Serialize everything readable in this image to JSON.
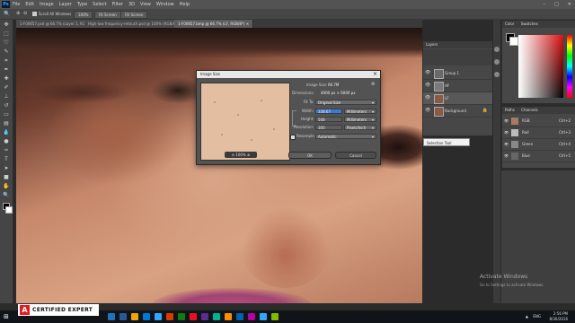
{
  "menubar": {
    "logo": "Ps",
    "items": [
      "File",
      "Edit",
      "Image",
      "Layer",
      "Type",
      "Select",
      "Filter",
      "3D",
      "View",
      "Window",
      "Help"
    ]
  },
  "options": {
    "scroll_all": "Scroll All Windows",
    "zoom_pct": "100%",
    "fit_screen": "Fit Screen",
    "fill_screen": "Fill Screen"
  },
  "tabs": [
    {
      "label": "1-F00657.psd @ 66.7% (Layer 1, RGB/8*) ×",
      "active": false
    },
    {
      "label": "High-low frequency-retouch.psd @ 100% (RGB/8) ×",
      "active": false
    },
    {
      "label": "1-F00657.bmp @ 66.7% (LF, RGB/8*) ×",
      "active": true
    }
  ],
  "layers_panel": {
    "tab": "Layers",
    "rows": [
      {
        "name": "Group 1",
        "selected": false
      },
      {
        "name": "HF",
        "selected": false
      },
      {
        "name": "LF",
        "selected": true
      },
      {
        "name": "Background",
        "selected": false
      }
    ]
  },
  "color_panel": {
    "tabs": [
      "Color",
      "Swatches"
    ],
    "colors": {
      "foreground": "#000000",
      "background": "#ffffff"
    }
  },
  "channels_panel": {
    "tabs": [
      "Paths",
      "Channels"
    ],
    "rows": [
      {
        "name": "RGB",
        "shortcut": "Ctrl+2"
      },
      {
        "name": "Red",
        "shortcut": "Ctrl+3"
      },
      {
        "name": "Green",
        "shortcut": "Ctrl+4"
      },
      {
        "name": "Blue",
        "shortcut": "Ctrl+5"
      }
    ]
  },
  "selection_tool": "Selection Tool",
  "dialog": {
    "title": "Image Size",
    "image_size_label": "Image Size:",
    "image_size_value": "66.7M",
    "dimensions_label": "Dimensions:",
    "dimensions_value": "4000 px × 6000 px",
    "fit_to_label": "Fit To:",
    "fit_to_value": "Original Size",
    "width_label": "Width:",
    "width_value": "338.67",
    "width_unit": "Millimeters",
    "height_label": "Height:",
    "height_value": "508",
    "height_unit": "Millimeters",
    "resolution_label": "Resolution:",
    "resolution_value": "300",
    "resolution_unit": "Pixels/Inch",
    "resample_label": "Resample:",
    "resample_value": "Automatic",
    "zoom": "100%",
    "ok": "OK",
    "cancel": "Cancel"
  },
  "watermark": {
    "line1": "Activate Windows",
    "line2": "Go to Settings to activate Windows."
  },
  "badge": {
    "logo": "A",
    "text": "CERTIFIED EXPERT"
  },
  "taskbar": {
    "lang": "ENG",
    "time": "2:56 PM",
    "date": "8/30/2016",
    "icon_colors": [
      "#1e73be",
      "#2b579a",
      "#f0a30a",
      "#0078d7",
      "#31a8ff",
      "#d83b01",
      "#107c10",
      "#e81123",
      "#5c2d91",
      "#00b294",
      "#ff8c00",
      "#0063b1",
      "#b4009e",
      "#31a8ff",
      "#7fba00"
    ]
  }
}
